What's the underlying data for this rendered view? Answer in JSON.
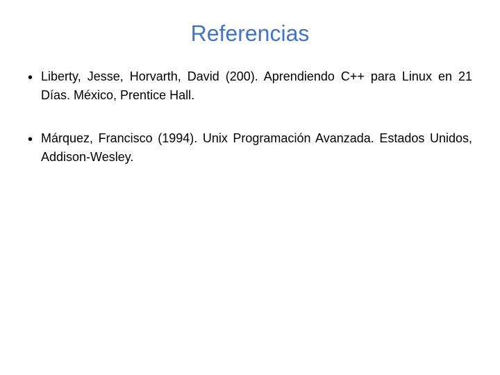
{
  "page": {
    "title": "Referencias",
    "title_color": "#4472c4"
  },
  "references": [
    {
      "id": "ref1",
      "text": "Liberty, Jesse, Horvarth, David (200). Aprendiendo C++ para Linux en 21 Días. México, Prentice Hall."
    },
    {
      "id": "ref2",
      "text": "Márquez, Francisco (1994). Unix Programación Avanzada. Estados Unidos, Addison-Wesley."
    }
  ],
  "bullet": "•"
}
